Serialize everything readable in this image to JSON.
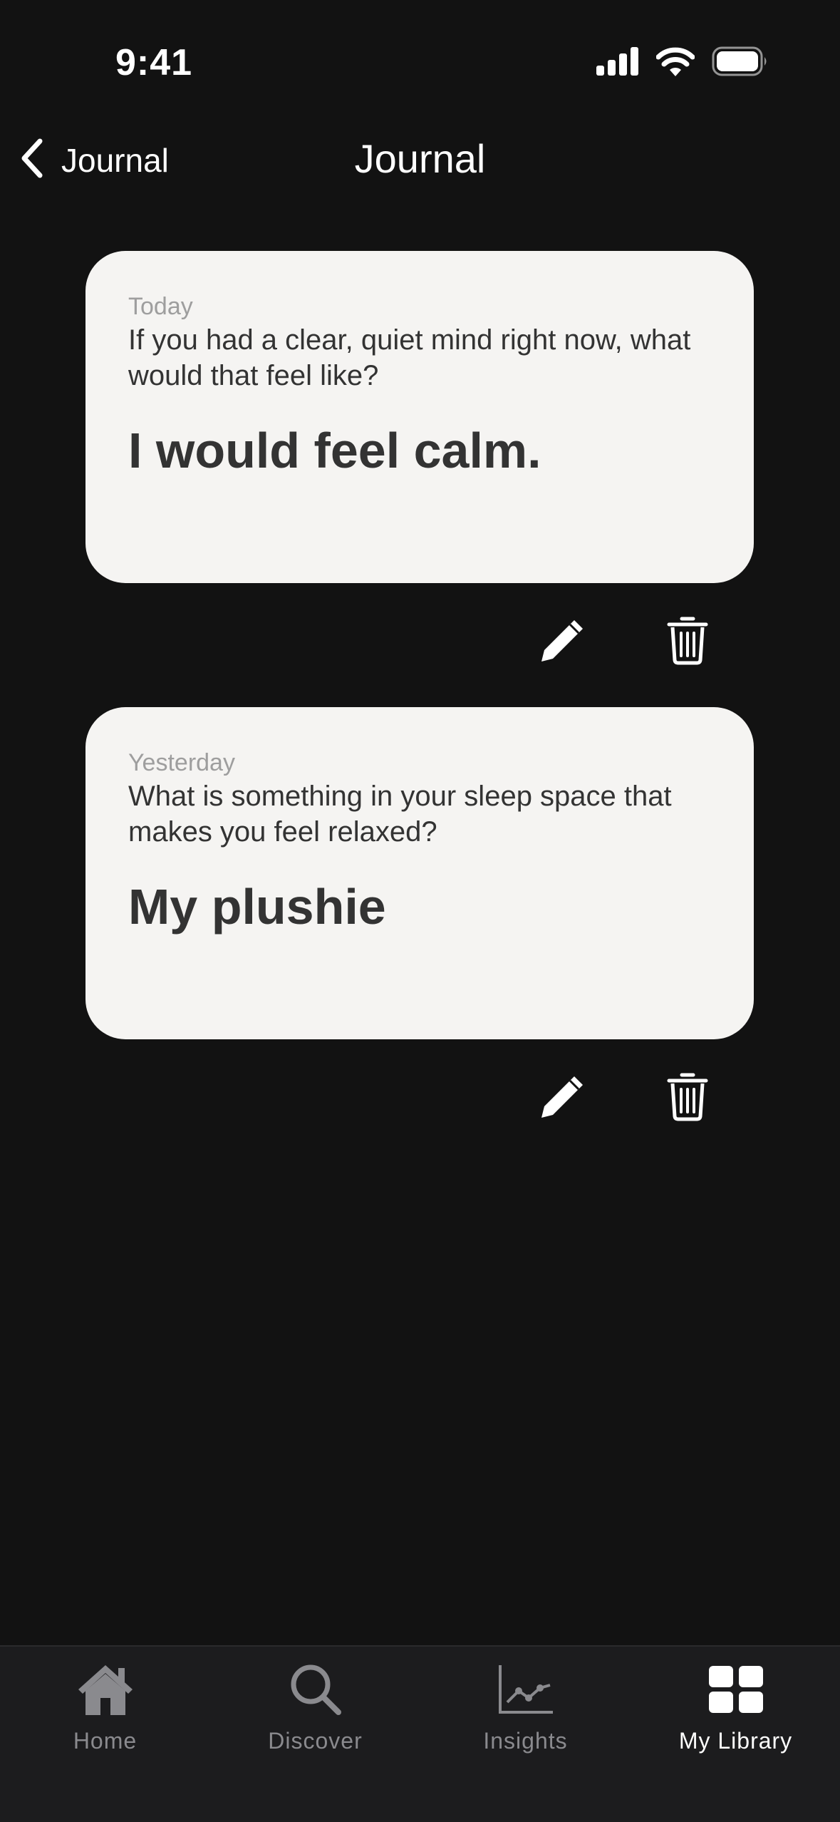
{
  "status_bar": {
    "time": "9:41"
  },
  "nav": {
    "back_label": "Journal",
    "title": "Journal"
  },
  "entries": [
    {
      "date": "Today",
      "question": "If you had a clear, quiet mind right now, what would that feel like?",
      "answer": "I would feel calm."
    },
    {
      "date": "Yesterday",
      "question": "What is something in your sleep space that makes you feel relaxed?",
      "answer": "My plushie"
    }
  ],
  "tabs": [
    {
      "label": "Home",
      "icon": "home-icon",
      "active": false
    },
    {
      "label": "Discover",
      "icon": "search-icon",
      "active": false
    },
    {
      "label": "Insights",
      "icon": "chart-icon",
      "active": false
    },
    {
      "label": "My Library",
      "icon": "grid-icon",
      "active": true
    }
  ],
  "colors": {
    "background": "#121212",
    "card": "#f5f4f2",
    "tab_bar": "#1c1c1e",
    "tab_inactive": "#8a8a8e",
    "tab_active": "#ffffff"
  }
}
